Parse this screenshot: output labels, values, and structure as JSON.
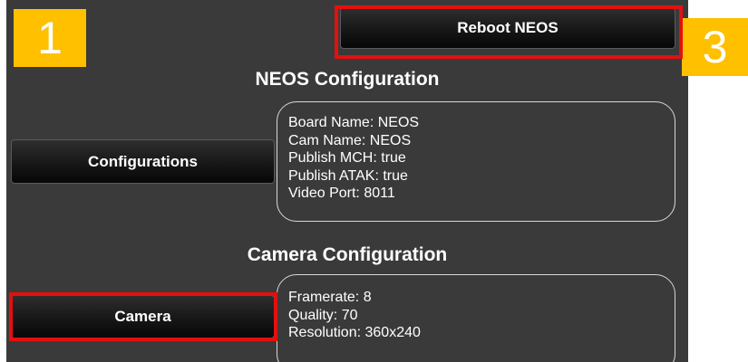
{
  "header": {
    "reboot_label": "Reboot NEOS"
  },
  "neos_section": {
    "title": "NEOS Configuration",
    "button_label": "Configurations",
    "info": [
      "Board Name: NEOS",
      "Cam Name: NEOS",
      "Publish MCH: true",
      "Publish ATAK: true",
      "Video Port: 8011"
    ]
  },
  "camera_section": {
    "title": "Camera Configuration",
    "button_label": "Camera",
    "info": [
      "Framerate: 8",
      "Quality: 70",
      "Resolution: 360x240"
    ]
  },
  "annotations": {
    "badge_left": "1",
    "badge_right": "3",
    "highlight_color": "#e31010",
    "badge_color": "#ffc000"
  }
}
